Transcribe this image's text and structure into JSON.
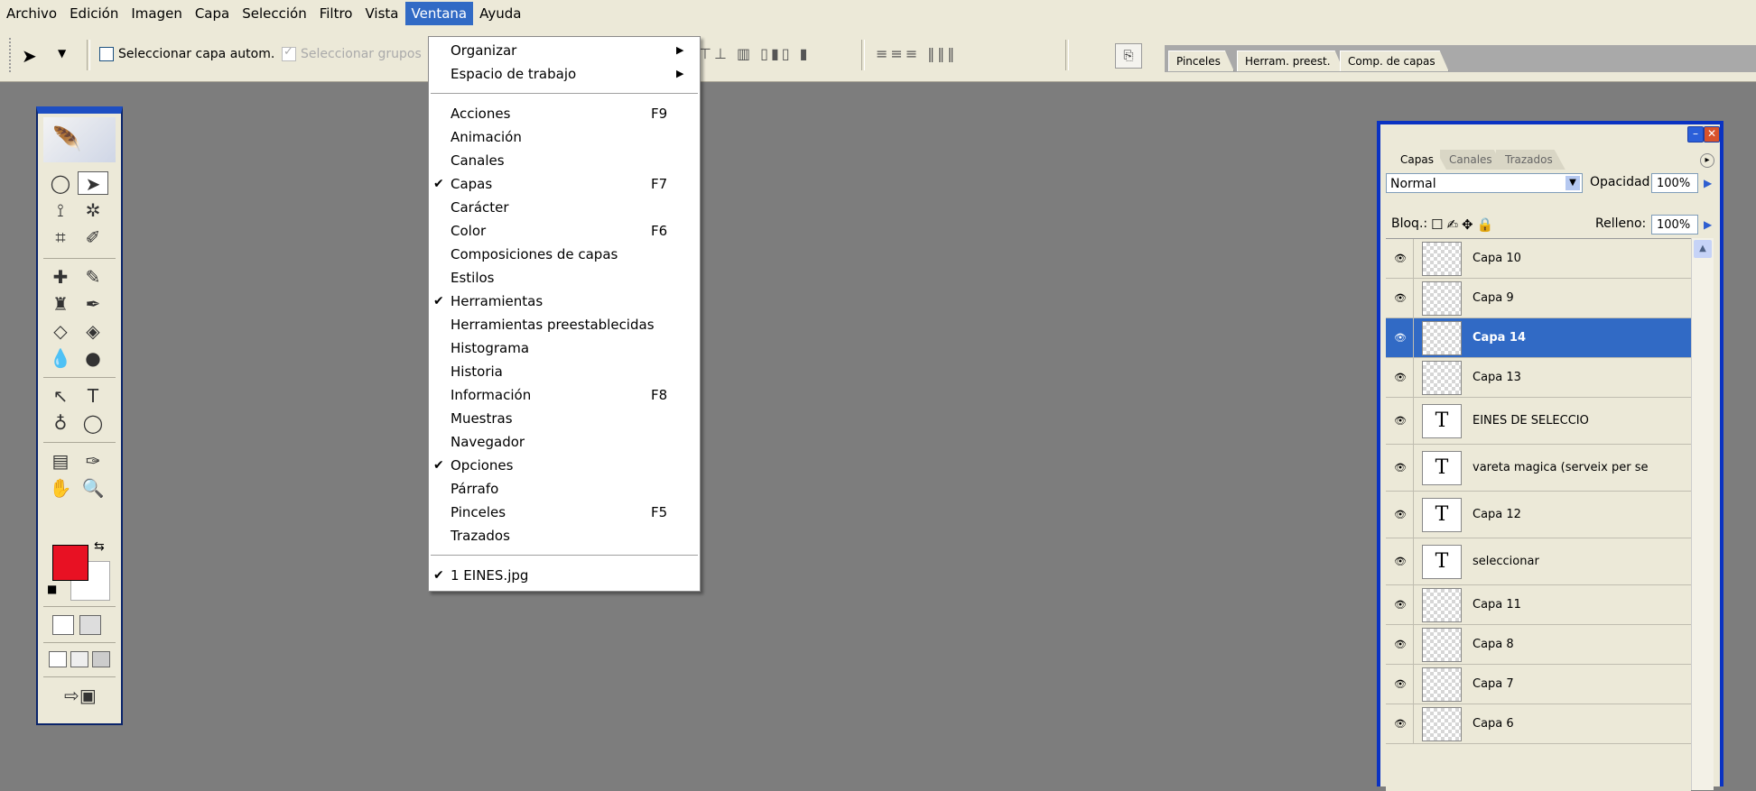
{
  "menubar": {
    "items": [
      "Archivo",
      "Edición",
      "Imagen",
      "Capa",
      "Selección",
      "Filtro",
      "Vista",
      "Ventana",
      "Ayuda"
    ],
    "active": "Ventana"
  },
  "options_bar": {
    "auto_select_layer": "Seleccionar capa autom.",
    "auto_select_groups": "Seleccionar grupos",
    "dock_tabs": [
      "Pinceles",
      "Herram. preest.",
      "Comp. de capas"
    ]
  },
  "window_menu": {
    "items": [
      {
        "label": "Organizar",
        "shortcut": "",
        "checked": false,
        "submenu": true
      },
      {
        "label": "Espacio de trabajo",
        "shortcut": "",
        "checked": false,
        "submenu": true
      },
      {
        "label": "Acciones",
        "shortcut": "F9",
        "checked": false,
        "submenu": false
      },
      {
        "label": "Animación",
        "shortcut": "",
        "checked": false,
        "submenu": false
      },
      {
        "label": "Canales",
        "shortcut": "",
        "checked": false,
        "submenu": false
      },
      {
        "label": "Capas",
        "shortcut": "F7",
        "checked": true,
        "submenu": false
      },
      {
        "label": "Carácter",
        "shortcut": "",
        "checked": false,
        "submenu": false
      },
      {
        "label": "Color",
        "shortcut": "F6",
        "checked": false,
        "submenu": false
      },
      {
        "label": "Composiciones de capas",
        "shortcut": "",
        "checked": false,
        "submenu": false
      },
      {
        "label": "Estilos",
        "shortcut": "",
        "checked": false,
        "submenu": false
      },
      {
        "label": "Herramientas",
        "shortcut": "",
        "checked": true,
        "submenu": false
      },
      {
        "label": "Herramientas preestablecidas",
        "shortcut": "",
        "checked": false,
        "submenu": false
      },
      {
        "label": "Histograma",
        "shortcut": "",
        "checked": false,
        "submenu": false
      },
      {
        "label": "Historia",
        "shortcut": "",
        "checked": false,
        "submenu": false
      },
      {
        "label": "Información",
        "shortcut": "F8",
        "checked": false,
        "submenu": false
      },
      {
        "label": "Muestras",
        "shortcut": "",
        "checked": false,
        "submenu": false
      },
      {
        "label": "Navegador",
        "shortcut": "",
        "checked": false,
        "submenu": false
      },
      {
        "label": "Opciones",
        "shortcut": "",
        "checked": true,
        "submenu": false
      },
      {
        "label": "Párrafo",
        "shortcut": "",
        "checked": false,
        "submenu": false
      },
      {
        "label": "Pinceles",
        "shortcut": "F5",
        "checked": false,
        "submenu": false
      },
      {
        "label": "Trazados",
        "shortcut": "",
        "checked": false,
        "submenu": false
      },
      {
        "label": "1 EINES.jpg",
        "shortcut": "",
        "checked": true,
        "submenu": false
      }
    ]
  },
  "toolbox": {
    "foreground_color": "#e81123",
    "background_color": "#ffffff"
  },
  "layers_panel": {
    "tabs": [
      "Capas",
      "Canales",
      "Trazados"
    ],
    "active_tab": "Capas",
    "blend_mode": "Normal",
    "opacity_label": "Opacidad:",
    "opacity_value": "100%",
    "lock_label": "Bloq.:",
    "fill_label": "Relleno:",
    "fill_value": "100%",
    "layers": [
      {
        "name": "Capa 10",
        "type": "raster",
        "selected": false
      },
      {
        "name": "Capa 9",
        "type": "raster",
        "selected": false
      },
      {
        "name": "Capa 14",
        "type": "raster",
        "selected": true
      },
      {
        "name": "Capa 13",
        "type": "raster",
        "selected": false
      },
      {
        "name": "EINES DE SELECCIO",
        "type": "text",
        "selected": false
      },
      {
        "name": "vareta magica (serveix per se",
        "type": "text",
        "selected": false
      },
      {
        "name": "Capa 12",
        "type": "text",
        "selected": false
      },
      {
        "name": "seleccionar",
        "type": "text",
        "selected": false
      },
      {
        "name": "Capa 11",
        "type": "raster",
        "selected": false
      },
      {
        "name": "Capa 8",
        "type": "raster",
        "selected": false
      },
      {
        "name": "Capa 7",
        "type": "raster",
        "selected": false
      },
      {
        "name": "Capa 6",
        "type": "raster",
        "selected": false
      }
    ],
    "text_thumb_glyph": "T"
  }
}
